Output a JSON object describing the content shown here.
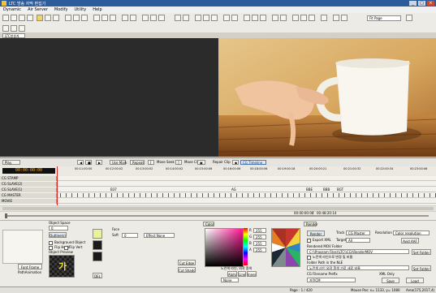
{
  "window": {
    "title": "LTC 방송 자막 편집기"
  },
  "menu": [
    {
      "label": "Dynamic"
    },
    {
      "label": "Air Server"
    },
    {
      "label": "Modify"
    },
    {
      "label": "Utility"
    },
    {
      "label": "Help"
    }
  ],
  "toolbar": {
    "page_select": "Fit Page"
  },
  "document_tab": {
    "label": "LTC방송자막.sgp"
  },
  "transport": {
    "play": "Play",
    "use_mark": "Use Mark",
    "repeat": "Repeat",
    "move_seek": "Move Seek",
    "move_clip": "Move Clip",
    "repair_clip": "Repair Clip",
    "cg_timeline": "CG Timeline"
  },
  "timeline": {
    "timecode": "00:00:00:00",
    "ticks": [
      "00:11:00:00",
      "00:12:00:02",
      "00:13:00:02",
      "00:14:00:02",
      "00:15:00:06",
      "00:16:00:06",
      "00:18:00:06",
      "00:19:00:18",
      "00:20:00:21",
      "00:21:00:32",
      "00:22:00:34",
      "00:23:00:06"
    ],
    "markers": [
      "B37",
      "AG",
      "BBE",
      "BBB",
      "BGT"
    ],
    "tracks": [
      {
        "label": "CG STAMP"
      },
      {
        "label": "CG SLAVE(2)"
      },
      {
        "label": "CG SLAVE(1)"
      },
      {
        "label": "CG MASTER"
      },
      {
        "label": "MOVIE"
      }
    ]
  },
  "position": {
    "current": "00:00:00:00",
    "total": "00:48:20:14"
  },
  "object_panel": {
    "object_space_label": "Object Space",
    "object_space_value": "0",
    "outline_label": "Outline(s)",
    "background_object": "Background Object",
    "flip_horizontal": "Flip Horiz",
    "flip_vertical": "Flip Vert",
    "object_preview": "Object Preview",
    "preview_char": "가",
    "font_frame": "Font Frame",
    "path_animation": "PathAnimation",
    "face_label": "Face",
    "soft_label": "Soft",
    "soft_value": "0",
    "effect_select": "Effect None",
    "del_label": "DEL",
    "cut_edge": "Cut Edge",
    "cut_shadow": "Cut Shadow"
  },
  "color_panel": {
    "tab": "Color",
    "alpha_label": "Alpha",
    "line_label": "Line",
    "inner_label": "Inner",
    "none_label": "None",
    "rgb": [
      {
        "label": "R",
        "value": "255"
      },
      {
        "label": "G",
        "value": "255"
      },
      {
        "label": "B",
        "value": "255"
      },
      {
        "label": "A",
        "value": "255"
      }
    ],
    "color_name": "노란색 라인, 외곽 흰색"
  },
  "render_panel": {
    "tab": "Render",
    "render_button": "Render",
    "track_label": "Track",
    "track_value": "CG Master",
    "resolution_label": "Resolution",
    "resolution_value": "Color resolution",
    "export_xml": "Export XML",
    "target_label": "Target",
    "target_value": "All",
    "avid_aaf": "Avid AAF",
    "rendered_folder_label": "Rendered MOV Folder",
    "rendered_folder_value": "C:\\\\Program Files\\\\LTC\\\\CG\\\\RenderMOV",
    "set_folder": "Set Folder",
    "check_label": "노란색 라인으로 변경 및 비율",
    "path_folder_label": "Folder Path in the NLE",
    "path_folder_value": "노란색 라인 외곽 흰색 가로 세로 비율",
    "filename_prefix_label": "CG Filename Prefix",
    "filename_prefix_value": "자막CM",
    "xml_only": "XML Only",
    "save": "Save",
    "load": "Load"
  },
  "status": {
    "page": "Page : 1 / 420",
    "mouse": "Mouse Pos: x= 1133, y= 1080",
    "area": "Area(175,2017,4)"
  },
  "colors": {
    "titlebar": "#2c5d9a",
    "timecode": "#ffb52e",
    "playhead": "#e02020",
    "accent": "#4a78b5"
  }
}
